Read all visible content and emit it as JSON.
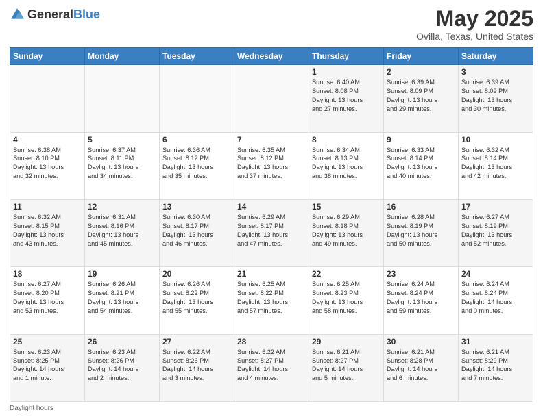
{
  "header": {
    "logo_general": "General",
    "logo_blue": "Blue",
    "month_year": "May 2025",
    "location": "Ovilla, Texas, United States"
  },
  "days_of_week": [
    "Sunday",
    "Monday",
    "Tuesday",
    "Wednesday",
    "Thursday",
    "Friday",
    "Saturday"
  ],
  "weeks": [
    [
      {
        "day": "",
        "info": ""
      },
      {
        "day": "",
        "info": ""
      },
      {
        "day": "",
        "info": ""
      },
      {
        "day": "",
        "info": ""
      },
      {
        "day": "1",
        "info": "Sunrise: 6:40 AM\nSunset: 8:08 PM\nDaylight: 13 hours\nand 27 minutes."
      },
      {
        "day": "2",
        "info": "Sunrise: 6:39 AM\nSunset: 8:09 PM\nDaylight: 13 hours\nand 29 minutes."
      },
      {
        "day": "3",
        "info": "Sunrise: 6:39 AM\nSunset: 8:09 PM\nDaylight: 13 hours\nand 30 minutes."
      }
    ],
    [
      {
        "day": "4",
        "info": "Sunrise: 6:38 AM\nSunset: 8:10 PM\nDaylight: 13 hours\nand 32 minutes."
      },
      {
        "day": "5",
        "info": "Sunrise: 6:37 AM\nSunset: 8:11 PM\nDaylight: 13 hours\nand 34 minutes."
      },
      {
        "day": "6",
        "info": "Sunrise: 6:36 AM\nSunset: 8:12 PM\nDaylight: 13 hours\nand 35 minutes."
      },
      {
        "day": "7",
        "info": "Sunrise: 6:35 AM\nSunset: 8:12 PM\nDaylight: 13 hours\nand 37 minutes."
      },
      {
        "day": "8",
        "info": "Sunrise: 6:34 AM\nSunset: 8:13 PM\nDaylight: 13 hours\nand 38 minutes."
      },
      {
        "day": "9",
        "info": "Sunrise: 6:33 AM\nSunset: 8:14 PM\nDaylight: 13 hours\nand 40 minutes."
      },
      {
        "day": "10",
        "info": "Sunrise: 6:32 AM\nSunset: 8:14 PM\nDaylight: 13 hours\nand 42 minutes."
      }
    ],
    [
      {
        "day": "11",
        "info": "Sunrise: 6:32 AM\nSunset: 8:15 PM\nDaylight: 13 hours\nand 43 minutes."
      },
      {
        "day": "12",
        "info": "Sunrise: 6:31 AM\nSunset: 8:16 PM\nDaylight: 13 hours\nand 45 minutes."
      },
      {
        "day": "13",
        "info": "Sunrise: 6:30 AM\nSunset: 8:17 PM\nDaylight: 13 hours\nand 46 minutes."
      },
      {
        "day": "14",
        "info": "Sunrise: 6:29 AM\nSunset: 8:17 PM\nDaylight: 13 hours\nand 47 minutes."
      },
      {
        "day": "15",
        "info": "Sunrise: 6:29 AM\nSunset: 8:18 PM\nDaylight: 13 hours\nand 49 minutes."
      },
      {
        "day": "16",
        "info": "Sunrise: 6:28 AM\nSunset: 8:19 PM\nDaylight: 13 hours\nand 50 minutes."
      },
      {
        "day": "17",
        "info": "Sunrise: 6:27 AM\nSunset: 8:19 PM\nDaylight: 13 hours\nand 52 minutes."
      }
    ],
    [
      {
        "day": "18",
        "info": "Sunrise: 6:27 AM\nSunset: 8:20 PM\nDaylight: 13 hours\nand 53 minutes."
      },
      {
        "day": "19",
        "info": "Sunrise: 6:26 AM\nSunset: 8:21 PM\nDaylight: 13 hours\nand 54 minutes."
      },
      {
        "day": "20",
        "info": "Sunrise: 6:26 AM\nSunset: 8:22 PM\nDaylight: 13 hours\nand 55 minutes."
      },
      {
        "day": "21",
        "info": "Sunrise: 6:25 AM\nSunset: 8:22 PM\nDaylight: 13 hours\nand 57 minutes."
      },
      {
        "day": "22",
        "info": "Sunrise: 6:25 AM\nSunset: 8:23 PM\nDaylight: 13 hours\nand 58 minutes."
      },
      {
        "day": "23",
        "info": "Sunrise: 6:24 AM\nSunset: 8:24 PM\nDaylight: 13 hours\nand 59 minutes."
      },
      {
        "day": "24",
        "info": "Sunrise: 6:24 AM\nSunset: 8:24 PM\nDaylight: 14 hours\nand 0 minutes."
      }
    ],
    [
      {
        "day": "25",
        "info": "Sunrise: 6:23 AM\nSunset: 8:25 PM\nDaylight: 14 hours\nand 1 minute."
      },
      {
        "day": "26",
        "info": "Sunrise: 6:23 AM\nSunset: 8:26 PM\nDaylight: 14 hours\nand 2 minutes."
      },
      {
        "day": "27",
        "info": "Sunrise: 6:22 AM\nSunset: 8:26 PM\nDaylight: 14 hours\nand 3 minutes."
      },
      {
        "day": "28",
        "info": "Sunrise: 6:22 AM\nSunset: 8:27 PM\nDaylight: 14 hours\nand 4 minutes."
      },
      {
        "day": "29",
        "info": "Sunrise: 6:21 AM\nSunset: 8:27 PM\nDaylight: 14 hours\nand 5 minutes."
      },
      {
        "day": "30",
        "info": "Sunrise: 6:21 AM\nSunset: 8:28 PM\nDaylight: 14 hours\nand 6 minutes."
      },
      {
        "day": "31",
        "info": "Sunrise: 6:21 AM\nSunset: 8:29 PM\nDaylight: 14 hours\nand 7 minutes."
      }
    ]
  ],
  "footer": {
    "note": "Daylight hours"
  },
  "colors": {
    "header_bg": "#3a7fc1",
    "accent": "#3a7fc1"
  }
}
